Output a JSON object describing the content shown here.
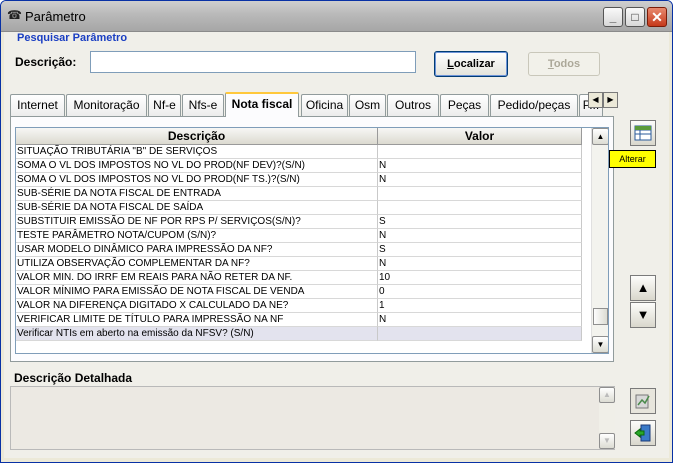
{
  "window": {
    "title": "Parâmetro",
    "minimize_glyph": "_",
    "maximize_glyph": "□",
    "close_glyph": "✕"
  },
  "search": {
    "section_title": "Pesquisar Parâmetro",
    "description_label": "Descrição:",
    "description_value": "",
    "localizar_label": "Localizar",
    "todos_label": "Todos"
  },
  "tabs": [
    {
      "label": "Internet"
    },
    {
      "label": "Monitoração"
    },
    {
      "label": "Nf-e"
    },
    {
      "label": "Nfs-e"
    },
    {
      "label": "Nota fiscal",
      "active": true
    },
    {
      "label": "Oficina"
    },
    {
      "label": "Osm"
    },
    {
      "label": "Outros"
    },
    {
      "label": "Peças"
    },
    {
      "label": "Pedido/peças"
    },
    {
      "label": "P..."
    }
  ],
  "grid": {
    "columns": [
      "Descrição",
      "Valor"
    ],
    "rows": [
      {
        "descricao": "SITUAÇÃO TRIBUTÁRIA \"B\" DE SERVIÇOS",
        "valor": ""
      },
      {
        "descricao": "SOMA O VL DOS IMPOSTOS NO VL DO PROD(NF DEV)?(S/N)",
        "valor": "N"
      },
      {
        "descricao": "SOMA O VL DOS IMPOSTOS NO VL DO PROD(NF TS.)?(S/N)",
        "valor": "N"
      },
      {
        "descricao": "SUB-SÉRIE DA NOTA FISCAL DE ENTRADA",
        "valor": ""
      },
      {
        "descricao": "SUB-SÉRIE DA NOTA FISCAL DE SAÍDA",
        "valor": ""
      },
      {
        "descricao": "SUBSTITUIR EMISSÃO DE NF POR RPS P/ SERVIÇOS(S/N)?",
        "valor": "S"
      },
      {
        "descricao": "TESTE PARÂMETRO NOTA/CUPOM (S/N)?",
        "valor": "N"
      },
      {
        "descricao": "USAR MODELO DINÂMICO PARA IMPRESSÃO DA NF?",
        "valor": "S"
      },
      {
        "descricao": "UTILIZA OBSERVAÇÃO COMPLEMENTAR DA NF?",
        "valor": "N"
      },
      {
        "descricao": "VALOR MIN. DO IRRF EM REAIS PARA NÃO RETER DA NF.",
        "valor": "10"
      },
      {
        "descricao": "VALOR MÍNIMO PARA EMISSÃO DE NOTA FISCAL DE VENDA",
        "valor": "0"
      },
      {
        "descricao": "VALOR NA DIFERENÇA DIGITADO X CALCULADO DA NE?",
        "valor": "1"
      },
      {
        "descricao": "VERIFICAR LIMITE DE TÍTULO PARA IMPRESSÃO NA NF",
        "valor": "N"
      },
      {
        "descricao": "Verificar NTIs em aberto na emissão da NFSV? (S/N)",
        "valor": "",
        "selected": true
      }
    ]
  },
  "tooltip": {
    "text": "Alterar"
  },
  "detail": {
    "label": "Descrição Detalhada",
    "text": ""
  },
  "icons": {
    "title": "phone-icon",
    "alterar": "edit-table-icon",
    "move_up": "arrow-up-icon",
    "move_down": "arrow-down-icon",
    "report": "report-icon",
    "exit": "exit-door-icon"
  }
}
